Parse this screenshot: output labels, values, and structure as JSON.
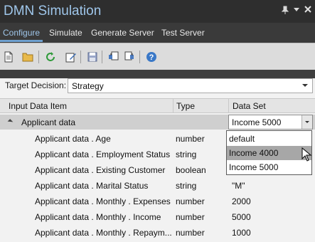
{
  "window": {
    "title": "DMN Simulation",
    "pin_icon": "pin-icon",
    "dropdown_icon": "chevron-down-icon",
    "close_icon": "close-icon"
  },
  "tabs": [
    {
      "label": "Configure",
      "active": true
    },
    {
      "label": "Simulate",
      "active": false
    },
    {
      "label": "Generate Server",
      "active": false
    },
    {
      "label": "Test Server",
      "active": false
    }
  ],
  "toolbar": {
    "buttons": [
      "new-icon",
      "open-folder-icon",
      "refresh-icon",
      "edit-icon",
      "save-icon",
      "copy-icon",
      "paste-icon",
      "help-icon"
    ]
  },
  "target_decision": {
    "label": "Target Decision:",
    "value": "Strategy"
  },
  "table": {
    "headers": {
      "input": "Input Data Item",
      "type": "Type",
      "dataset": "Data Set"
    },
    "group": {
      "label": "Applicant data",
      "dataset_value": "Income 5000"
    },
    "rows": [
      {
        "name": "Applicant data . Age",
        "type": "number",
        "value": ""
      },
      {
        "name": "Applicant data . Employment Status",
        "type": "string",
        "value": ""
      },
      {
        "name": "Applicant data . Existing Customer",
        "type": "boolean",
        "value": ""
      },
      {
        "name": "Applicant data . Marital Status",
        "type": "string",
        "value": "\"M\""
      },
      {
        "name": "Applicant data . Monthly . Expenses",
        "type": "number",
        "value": "2000"
      },
      {
        "name": "Applicant data . Monthly . Income",
        "type": "number",
        "value": "5000"
      },
      {
        "name": "Applicant data . Monthly . Repaym...",
        "type": "number",
        "value": "1000"
      }
    ]
  },
  "dataset_dropdown": {
    "options": [
      "default",
      "Income 4000",
      "Income 5000"
    ],
    "hovered": "Income 4000"
  }
}
